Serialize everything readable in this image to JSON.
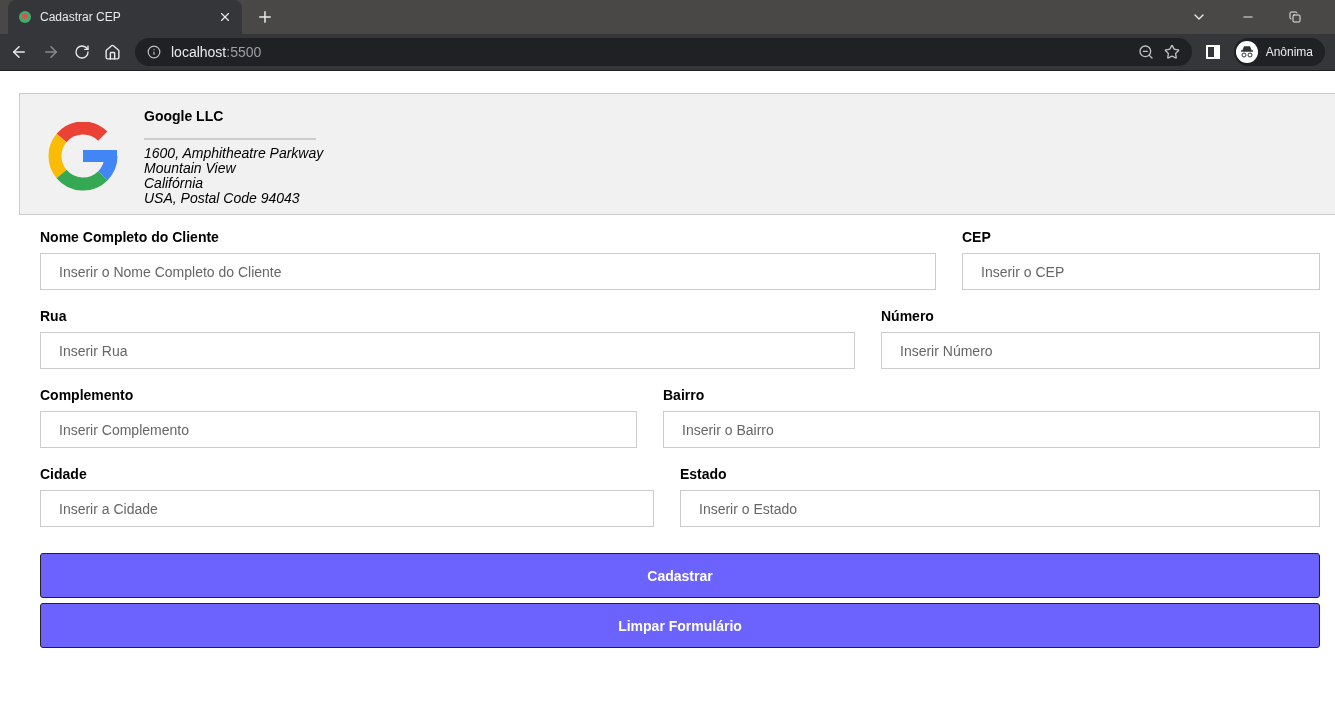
{
  "browser": {
    "tab": {
      "title": "Cadastrar CEP",
      "selected": true
    },
    "address": {
      "host": "localhost",
      "port": ":5500"
    },
    "profile": "Anônima"
  },
  "company": {
    "name": "Google LLC",
    "address_lines": [
      "1600, Amphitheatre Parkway",
      "Mountain View",
      "Califórnia",
      "USA, Postal Code 94043"
    ]
  },
  "form": {
    "rows": [
      [
        {
          "label": "Nome Completo do Cliente",
          "placeholder": "Inserir o Nome Completo do Cliente"
        },
        {
          "label": "CEP",
          "placeholder": "Inserir o CEP"
        }
      ],
      [
        {
          "label": "Rua",
          "placeholder": "Inserir Rua"
        },
        {
          "label": "Número",
          "placeholder": "Inserir Número"
        }
      ],
      [
        {
          "label": "Complemento",
          "placeholder": "Inserir Complemento"
        },
        {
          "label": "Bairro",
          "placeholder": "Inserir o Bairro"
        }
      ],
      [
        {
          "label": "Cidade",
          "placeholder": "Inserir a Cidade"
        },
        {
          "label": "Estado",
          "placeholder": "Inserir o Estado"
        }
      ]
    ],
    "buttons": [
      "Cadastrar",
      "Limpar Formulário"
    ]
  }
}
